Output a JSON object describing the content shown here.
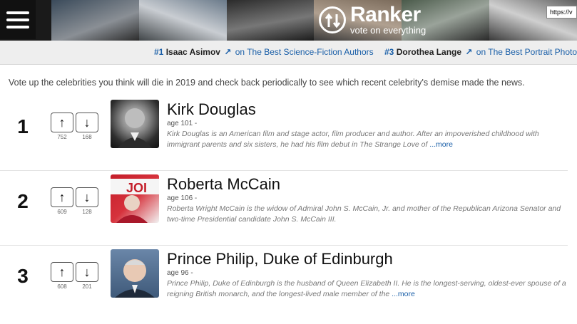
{
  "header": {
    "brand": "Ranker",
    "tagline": "vote on everything",
    "url_fragment": "https://v"
  },
  "trending": [
    {
      "rank": "#1",
      "name": "Isaac Asimov",
      "on": "on",
      "list": "The Best Science-Fiction Authors"
    },
    {
      "rank": "#3",
      "name": "Dorothea Lange",
      "on": "on",
      "list": "The Best Portrait Photogra"
    }
  ],
  "intro": "Vote up the celebrities you think will die in 2019 and check back periodically to see which recent celebrity's demise made the news.",
  "items": [
    {
      "rank": "1",
      "name": "Kirk Douglas",
      "age": "age 101 -",
      "up_count": "752",
      "down_count": "168",
      "desc": "Kirk Douglas is an American film and stage actor, film producer and author. After an impoverished childhood with immigrant parents and six sisters, he had his film debut in The Strange Love of ",
      "more": "...more"
    },
    {
      "rank": "2",
      "name": "Roberta McCain",
      "age": "age 106 -",
      "up_count": "609",
      "down_count": "128",
      "desc": "Roberta Wright McCain is the widow of Admiral John S. McCain, Jr. and mother of the Republican Arizona Senator and two-time Presidential candidate John S. McCain III.",
      "more": ""
    },
    {
      "rank": "3",
      "name": "Prince Philip, Duke of Edinburgh",
      "age": "age 96 -",
      "up_count": "608",
      "down_count": "201",
      "desc": "Prince Philip, Duke of Edinburgh is the husband of Queen Elizabeth II. He is the longest-serving, oldest-ever spouse of a reigning British monarch, and the longest-lived male member of the ",
      "more": "...more"
    }
  ],
  "vote_labels": {
    "up": "↑",
    "down": "↓"
  }
}
